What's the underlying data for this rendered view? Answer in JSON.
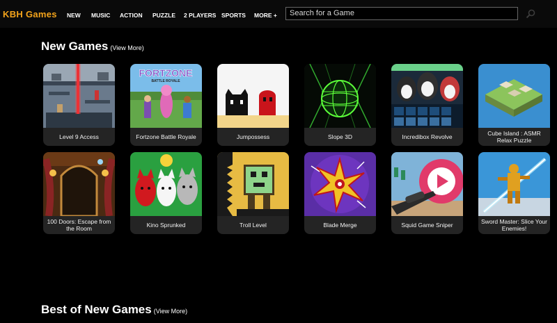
{
  "header": {
    "logo": "KBH Games",
    "nav": [
      "NEW",
      "MUSIC",
      "ACTION",
      "PUZZLE",
      "2 PLAYERS",
      "SPORTS",
      "MORE +"
    ],
    "search_placeholder": "Search for a Game",
    "search_icon": "magnifier-icon"
  },
  "sections": [
    {
      "title": "New Games",
      "view_more": "(View More)"
    },
    {
      "title": "Best of New Games",
      "view_more": "(View More)"
    }
  ],
  "games": [
    {
      "title": "Level 9 Access"
    },
    {
      "title": "Fortzone Battle Royale"
    },
    {
      "title": "Jumpossess"
    },
    {
      "title": "Slope 3D"
    },
    {
      "title": "Incredibox Revolve"
    },
    {
      "title": "Cube Island : ASMR Relax Puzzle"
    },
    {
      "title": "100 Doors: Escape from the Room"
    },
    {
      "title": "Kino Sprunked"
    },
    {
      "title": "Troll Level"
    },
    {
      "title": "Blade Merge"
    },
    {
      "title": "Squid Game Sniper"
    },
    {
      "title": "Sword Master: Slice Your Enemies!"
    }
  ],
  "thumbnail_text": {
    "fortzone_logo_line1": "FORTZONE",
    "fortzone_logo_line2": "BATTLE ROYALE"
  },
  "colors": {
    "logo": "#f3a31b",
    "background": "#000000",
    "card": "#242424"
  }
}
